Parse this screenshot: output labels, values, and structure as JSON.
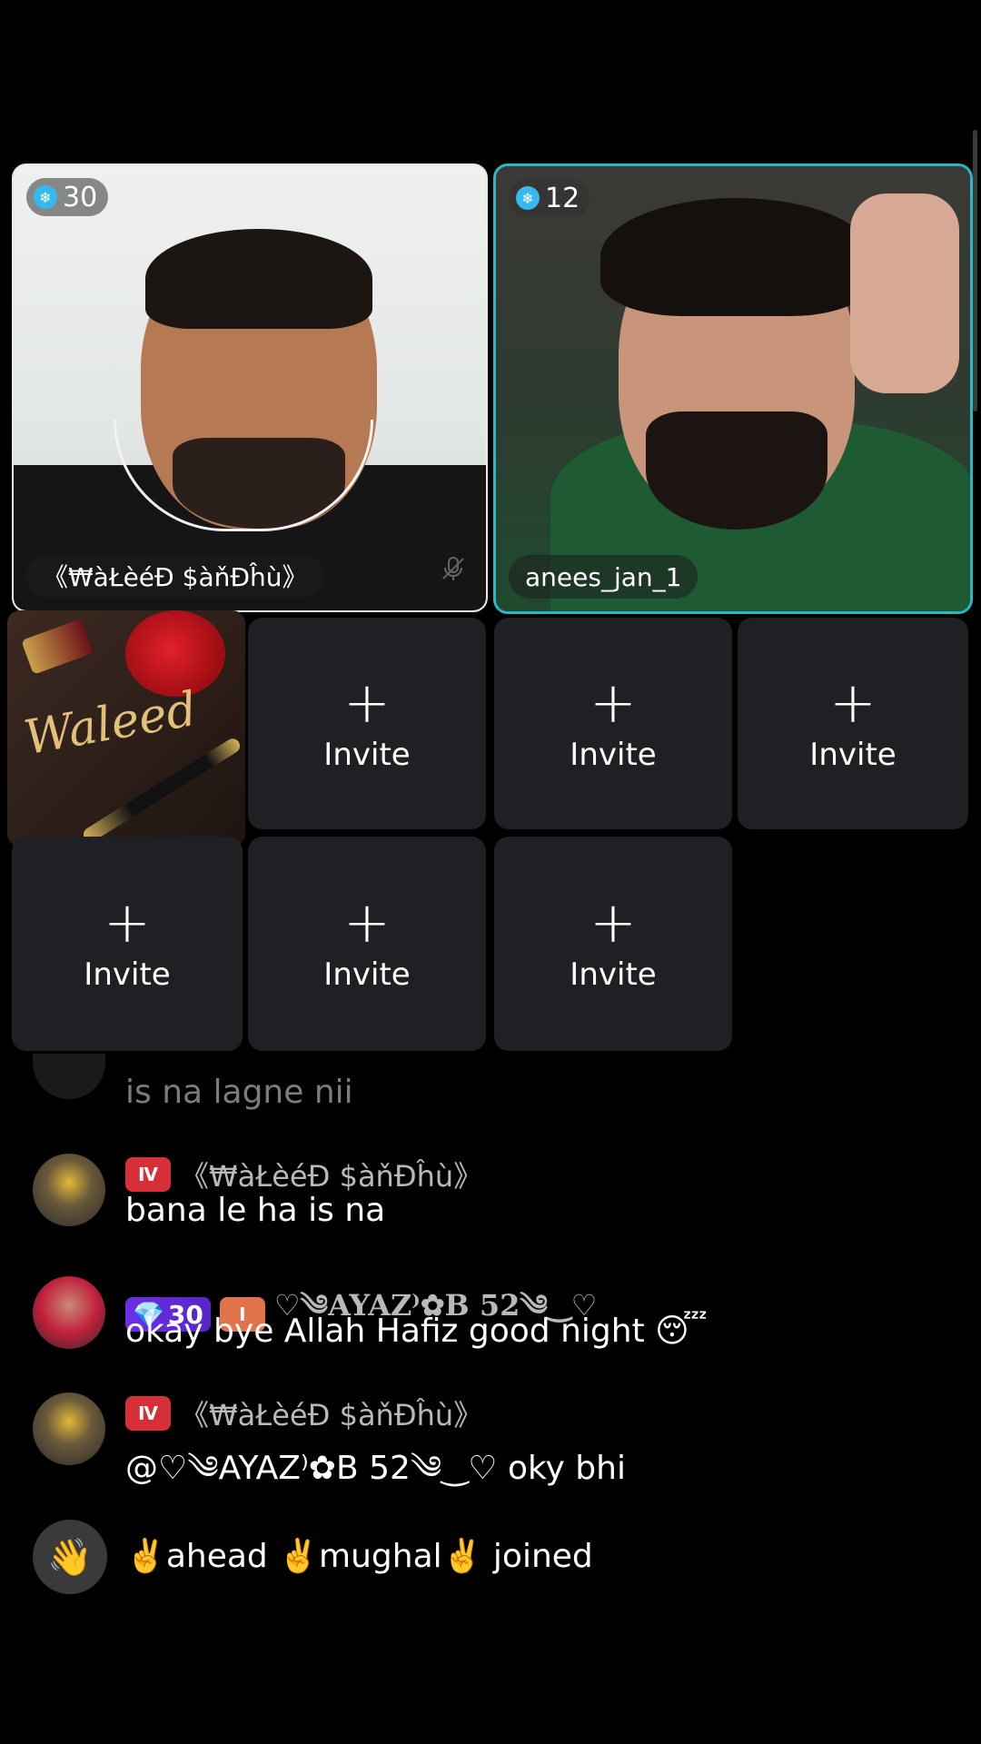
{
  "stage": {
    "host": {
      "gift_count": "30",
      "name": "《₩àŁèéĐ $àňĐĥù》"
    },
    "guest": {
      "gift_count": "12",
      "name": "anees_jan_1"
    },
    "avatar_tile_text": "Waleed",
    "invite_label": "Invite",
    "invite_plus": "+"
  },
  "chat": {
    "partial_message": "is na lagne nii",
    "messages": [
      {
        "badges": [
          "lv"
        ],
        "user": "《₩àŁèéĐ $àňĐĥù》",
        "text": "bana le ha is na"
      },
      {
        "badges": [
          "gem",
          "org"
        ],
        "gem_level": "30",
        "user": "♡༄AYAZ⁾✿B 52༄‿♡",
        "text": "okay bye Allah Hafiz good night 😴"
      },
      {
        "badges": [
          "lv"
        ],
        "user": "《₩àŁèéĐ $àňĐĥù》",
        "text": "@♡༄AYAZ⁾✿B 52༄‿♡ oky bhi"
      }
    ],
    "join_notice": "✌️ahead ✌️mughal✌️ joined"
  },
  "colors": {
    "accent": "#29b8c8",
    "tile_bg": "#1f2024",
    "badge_red": "#d62f37",
    "badge_purple": "#6c2fe6"
  }
}
